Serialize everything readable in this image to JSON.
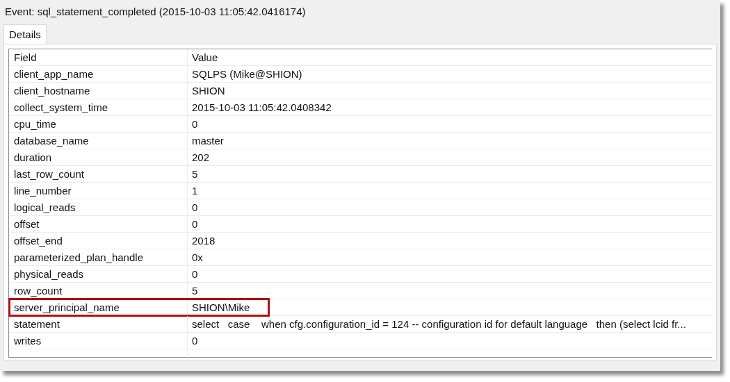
{
  "window": {
    "title": "Event: sql_statement_completed (2015-10-03 11:05:42.0416174)"
  },
  "tabs": [
    {
      "label": "Details",
      "selected": true
    }
  ],
  "table": {
    "columns": [
      "Field",
      "Value"
    ],
    "rows": [
      {
        "field": "client_app_name",
        "value": "SQLPS (Mike@SHION)",
        "highlighted": false
      },
      {
        "field": "client_hostname",
        "value": "SHION",
        "highlighted": false
      },
      {
        "field": "collect_system_time",
        "value": "2015-10-03 11:05:42.0408342",
        "highlighted": false
      },
      {
        "field": "cpu_time",
        "value": "0",
        "highlighted": false
      },
      {
        "field": "database_name",
        "value": "master",
        "highlighted": false
      },
      {
        "field": "duration",
        "value": "202",
        "highlighted": false
      },
      {
        "field": "last_row_count",
        "value": "5",
        "highlighted": false
      },
      {
        "field": "line_number",
        "value": "1",
        "highlighted": false
      },
      {
        "field": "logical_reads",
        "value": "0",
        "highlighted": false
      },
      {
        "field": "offset",
        "value": "0",
        "highlighted": false
      },
      {
        "field": "offset_end",
        "value": "2018",
        "highlighted": false
      },
      {
        "field": "parameterized_plan_handle",
        "value": "0x",
        "highlighted": false
      },
      {
        "field": "physical_reads",
        "value": "0",
        "highlighted": false
      },
      {
        "field": "row_count",
        "value": "5",
        "highlighted": false
      },
      {
        "field": "server_principal_name",
        "value": "SHION\\Mike",
        "highlighted": true
      },
      {
        "field": "statement",
        "value": "select   case    when cfg.configuration_id = 124 -- configuration id for default language   then (select lcid fr...",
        "highlighted": false
      },
      {
        "field": "writes",
        "value": "0",
        "highlighted": false
      }
    ]
  }
}
